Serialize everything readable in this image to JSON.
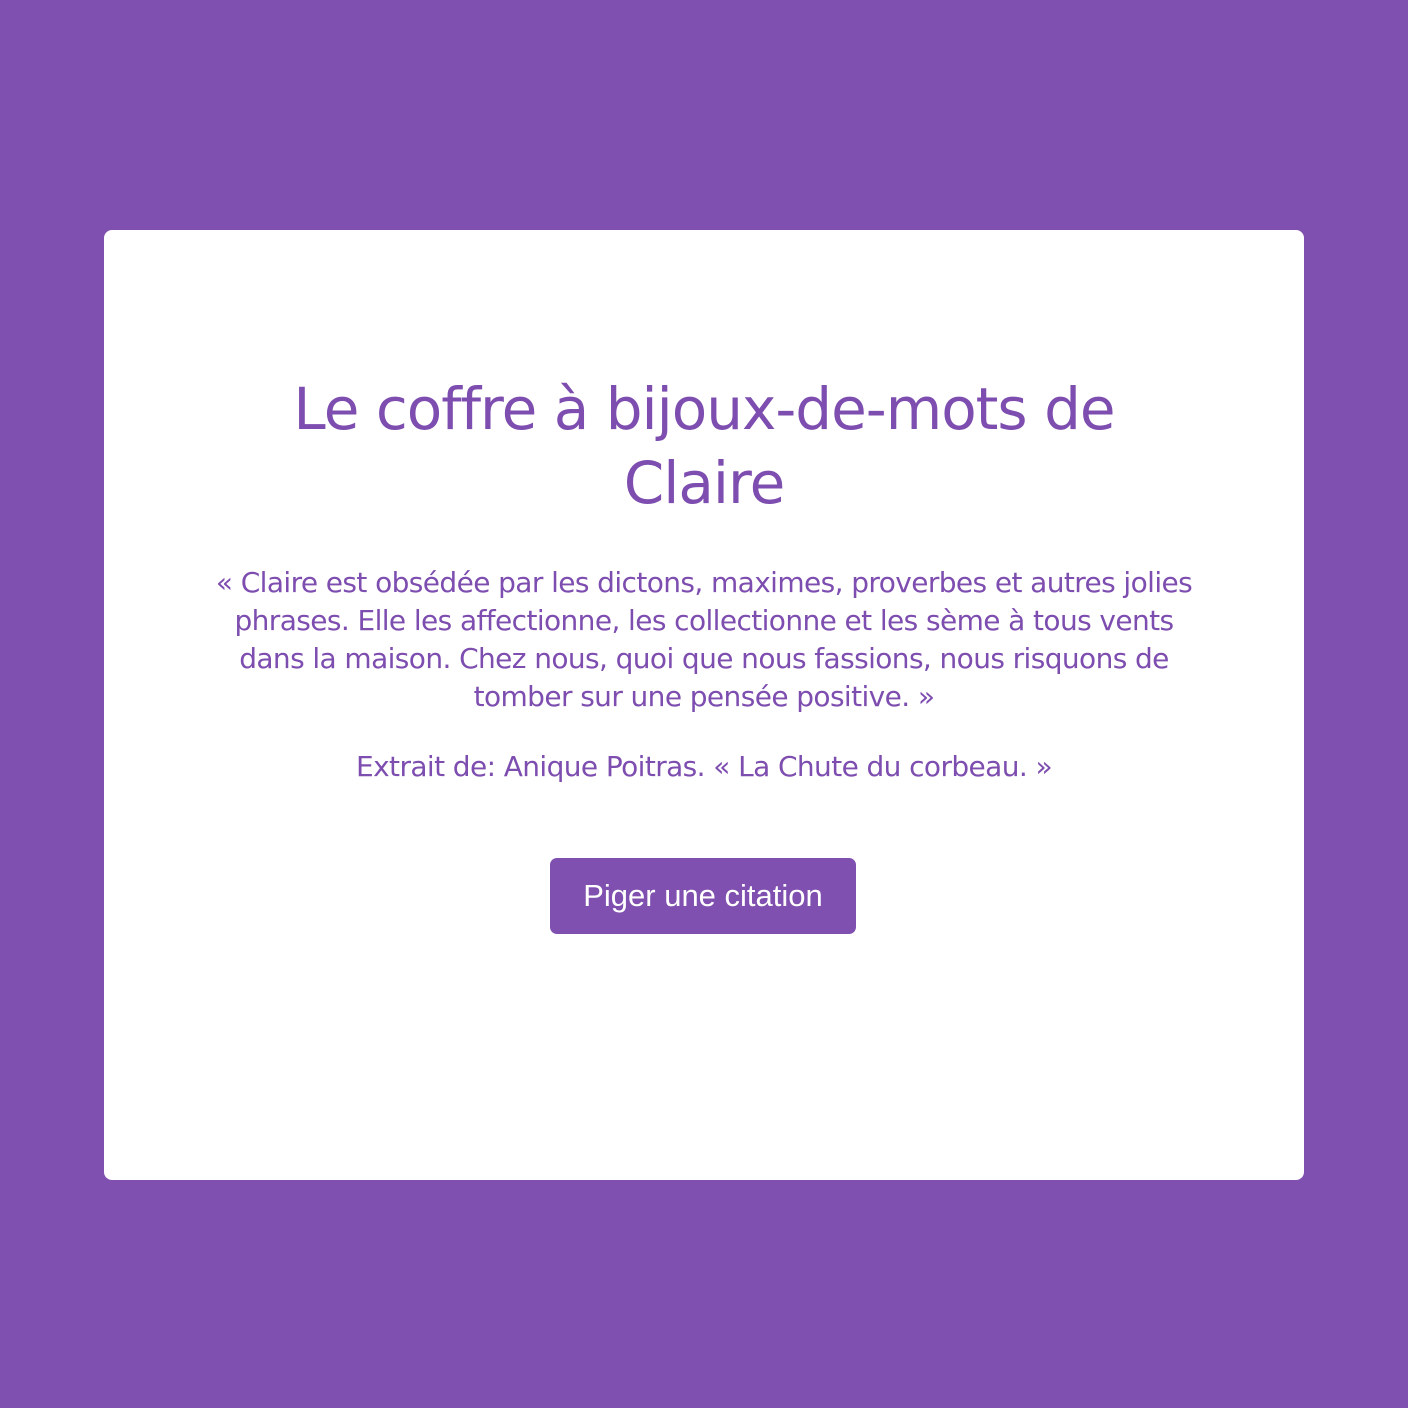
{
  "card": {
    "title": "Le coffre à bijoux-de-mots de Claire",
    "quote": "« Claire est obsédée par les dictons, maximes, proverbes et autres jolies phrases. Elle les affectionne, les collectionne et les sème à tous vents dans la maison. Chez nous, quoi que nous fassions, nous risquons de tomber sur une pensée positive. »",
    "source": "Extrait de: Anique Poitras. « La Chute du corbeau. »",
    "button_label": "Piger une citation"
  },
  "colors": {
    "background": "#8050b0",
    "card": "#ffffff",
    "accent_text": "#7d4daf",
    "button_text": "#ffffff"
  }
}
